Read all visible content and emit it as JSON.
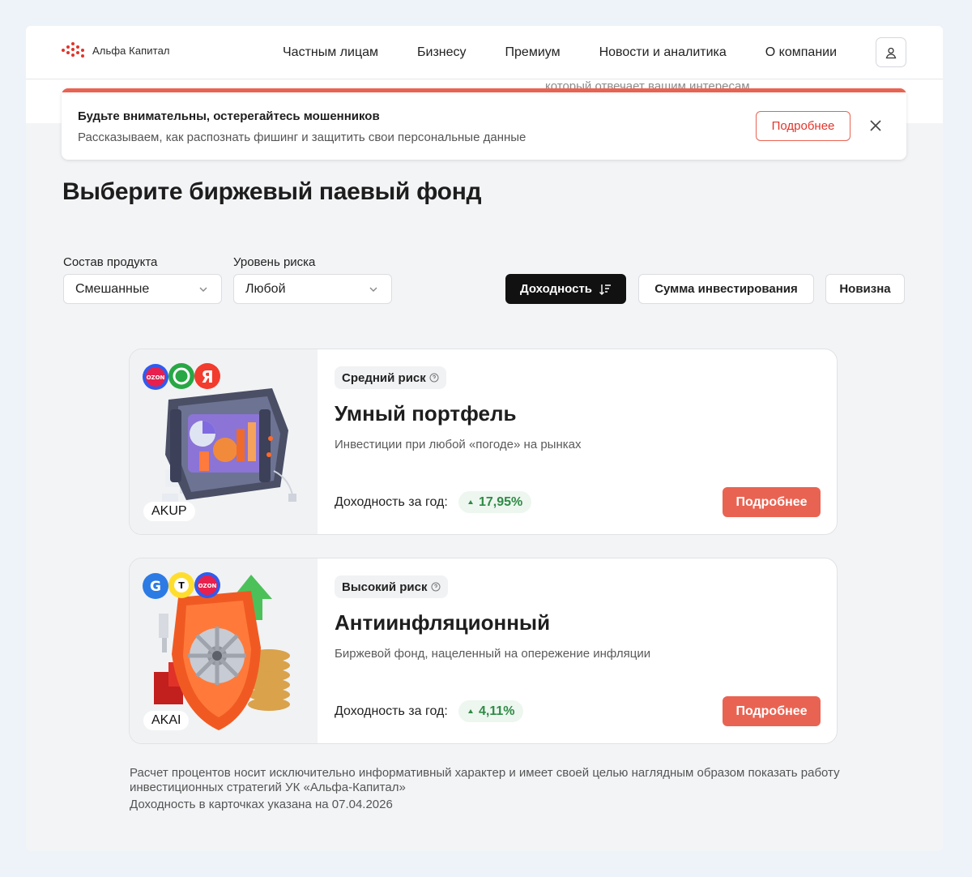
{
  "header": {
    "logo_text": "Альфа Капитал",
    "nav": [
      "Частным лицам",
      "Бизнесу",
      "Премиум",
      "Новости и аналитика",
      "О компании"
    ]
  },
  "ghost_text": "который отвечает вашим интересам",
  "alert": {
    "title": "Будьте внимательны, остерегайтесь мошенников",
    "text": "Рассказываем, как распознать фишинг и защитить свои персональные данные",
    "button": "Подробнее"
  },
  "page_title": "Выберите биржевый паевый фонд",
  "filters": {
    "composition": {
      "label": "Состав продукта",
      "value": "Смешанные"
    },
    "risk": {
      "label": "Уровень риска",
      "value": "Любой"
    }
  },
  "sort": {
    "yield": "Доходность",
    "amount": "Сумма инвестирования",
    "novelty": "Новизна"
  },
  "cards": [
    {
      "ticker": "AKUP",
      "risk": "Средний риск",
      "name": "Умный портфель",
      "description": "Инвестиции при любой «погоде» на рынках",
      "yield_label": "Доходность за год:",
      "yield": "17,95%",
      "button": "Подробнее"
    },
    {
      "ticker": "AKAI",
      "risk": "Высокий риск",
      "name": "Антиинфляционный",
      "description": "Биржевой фонд, нацеленный на опережение инфляции",
      "yield_label": "Доходность за год:",
      "yield": "4,11%",
      "button": "Подробнее"
    }
  ],
  "disclaimer": {
    "line1": "Расчет процентов носит исключительно информативный характер и имеет своей целью наглядным образом показать работу инвестиционных стратегий УК «Альфа-Капитал»",
    "line2": "Доходность в карточках указана на 07.04.2026"
  },
  "colors": {
    "accent": "#e96352",
    "positive": "#2f8a46",
    "dark": "#111111"
  }
}
